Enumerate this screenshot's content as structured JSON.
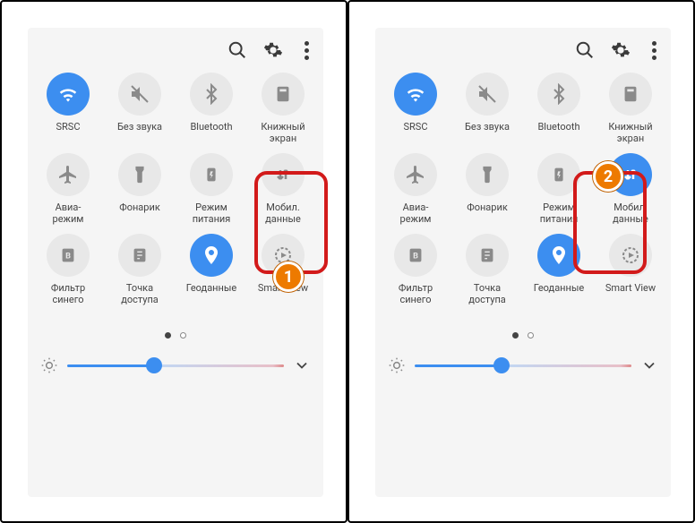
{
  "panels": [
    {
      "tiles": [
        {
          "key": "wifi",
          "icon": "wifi",
          "label": "SRSC",
          "active": true
        },
        {
          "key": "mute",
          "icon": "mute",
          "label": "Без звука",
          "active": false
        },
        {
          "key": "bluetooth",
          "icon": "bluetooth",
          "label": "Bluetooth",
          "active": false
        },
        {
          "key": "book",
          "icon": "book",
          "label": "Книжный\nэкран",
          "active": false
        },
        {
          "key": "airplane",
          "icon": "airplane",
          "label": "Авиа-\nрежим",
          "active": false
        },
        {
          "key": "flashlight",
          "icon": "flashlight",
          "label": "Фонарик",
          "active": false
        },
        {
          "key": "power",
          "icon": "power",
          "label": "Режим\nпитания",
          "active": false
        },
        {
          "key": "mobiledata",
          "icon": "mobiledata",
          "label": "Мобил.\nданные",
          "active": false
        },
        {
          "key": "bluefilter",
          "icon": "blue",
          "label": "Фильтр\nсинего",
          "active": false
        },
        {
          "key": "hotspot",
          "icon": "hotspot",
          "label": "Точка\nдоступа",
          "active": false
        },
        {
          "key": "location",
          "icon": "location",
          "label": "Геоданные",
          "active": true
        },
        {
          "key": "smartview",
          "icon": "smartview",
          "label": "Smart View",
          "active": false
        }
      ]
    },
    {
      "tiles": [
        {
          "key": "wifi",
          "icon": "wifi",
          "label": "SRSC",
          "active": true
        },
        {
          "key": "mute",
          "icon": "mute",
          "label": "Без звука",
          "active": false
        },
        {
          "key": "bluetooth",
          "icon": "bluetooth",
          "label": "Bluetooth",
          "active": false
        },
        {
          "key": "book",
          "icon": "book",
          "label": "Книжный\nэкран",
          "active": false
        },
        {
          "key": "airplane",
          "icon": "airplane",
          "label": "Авиа-\nрежим",
          "active": false
        },
        {
          "key": "flashlight",
          "icon": "flashlight",
          "label": "Фонарик",
          "active": false
        },
        {
          "key": "power",
          "icon": "power",
          "label": "Режим\nпитания",
          "active": false
        },
        {
          "key": "mobiledata",
          "icon": "mobiledata",
          "label": "Мобил.\nданные",
          "active": true
        },
        {
          "key": "bluefilter",
          "icon": "blue",
          "label": "Фильтр\nсинего",
          "active": false
        },
        {
          "key": "hotspot",
          "icon": "hotspot",
          "label": "Точка\nдоступа",
          "active": false
        },
        {
          "key": "location",
          "icon": "location",
          "label": "Геоданные",
          "active": true
        },
        {
          "key": "smartview",
          "icon": "smartview",
          "label": "Smart View",
          "active": false
        }
      ]
    }
  ],
  "annotations": {
    "a1": "1",
    "a2": "2"
  },
  "brightness_percent": 40
}
